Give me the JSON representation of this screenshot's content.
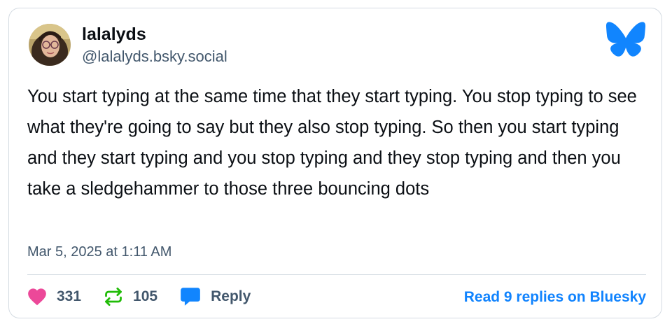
{
  "author": {
    "display_name": "lalalyds",
    "handle": "@lalalyds.bsky.social"
  },
  "post": {
    "text": "You start typing at the same time that they start typing. You stop typing to see what they're going to say but they also stop typing. So then you start typing and they start typing and you stop typing and they stop typing and then you take a sledgehammer to those three bouncing dots",
    "timestamp": "Mar 5, 2025 at 1:11 AM"
  },
  "actions": {
    "like_count": "331",
    "repost_count": "105",
    "reply_label": "Reply",
    "read_replies_label": "Read 9 replies on Bluesky"
  },
  "icons": {
    "brand": "bluesky-butterfly-icon",
    "like": "heart-icon",
    "repost": "repost-icon",
    "reply": "speech-bubble-icon"
  },
  "colors": {
    "brand_blue": "#1185fe",
    "like_pink": "#ec4899",
    "repost_green": "#20bc07",
    "link_blue": "#1083fe",
    "muted_text": "#42576c"
  }
}
